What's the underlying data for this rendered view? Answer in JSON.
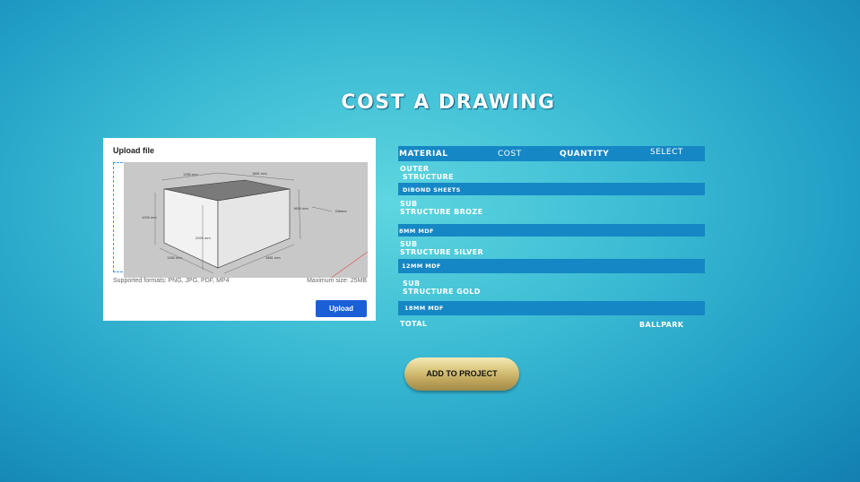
{
  "page": {
    "title": "COST A DRAWING"
  },
  "upload_card": {
    "heading": "Upload file",
    "formats": "Supported formats: PNG, JPG, PDF, MP4",
    "max_size": "Maximum size: 25MB",
    "upload_label": "Upload",
    "drawing_dims": {
      "top_left": "1280 mm",
      "top_right": "1661 mm",
      "left": "1000 mm",
      "right": "1600 mm",
      "front": "2000 mm",
      "bottom_left": "1280 mm",
      "bottom_right": "1661 mm",
      "callout": "Dibond"
    }
  },
  "table": {
    "headers": {
      "material": "MATERIAL",
      "cost": "COST",
      "quantity": "QUANTITY",
      "select": "SELECT"
    },
    "rows": [
      {
        "label_line1": "OUTER",
        "label_line2": "STRUCTURE",
        "sub": "DIBOND SHEETS"
      },
      {
        "label_line1": "SUB",
        "label_line2": "STRUCTURE BROZE",
        "sub": "8MM MDF"
      },
      {
        "label_line1": "SUB",
        "label_line2": "STRUCTURE SILVER",
        "sub": "12MM MDF"
      },
      {
        "label_line1": "SUB",
        "label_line2": "STRUCTURE GOLD",
        "sub": "18MM MDF"
      }
    ],
    "total_label": "TOTAL",
    "ballpark_label": "BALLPARK"
  },
  "actions": {
    "add_to_project": "ADD TO PROJECT"
  },
  "colors": {
    "bar": "#1587c4",
    "upload_button": "#1a5fd6",
    "add_button": "#d4bf78"
  }
}
